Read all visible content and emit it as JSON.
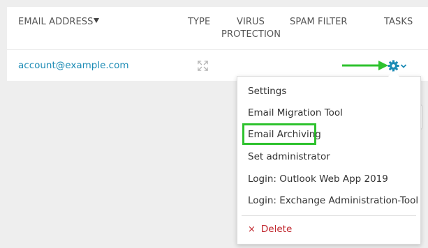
{
  "table": {
    "headers": {
      "email": "EMAIL ADDRESS",
      "type": "TYPE",
      "virus_line1": "VIRUS",
      "virus_line2": "PROTECTION",
      "spam": "SPAM FILTER",
      "tasks": "TASKS"
    },
    "rows": [
      {
        "email": "account@example.com",
        "type_icon": "expand-arrows-icon"
      }
    ]
  },
  "menu": {
    "items": [
      "Settings",
      "Email Migration Tool",
      "Email Archiving",
      "Set administrator",
      "Login: Outlook Web App 2019",
      "Login: Exchange Administration-Tool"
    ],
    "highlighted_item": "Email Archiving",
    "delete_label": "Delete",
    "delete_icon": "×"
  },
  "colors": {
    "link": "#1c8bb5",
    "highlight": "#2ec22e",
    "delete": "#c0262d",
    "gear": "#1c8bb5"
  }
}
